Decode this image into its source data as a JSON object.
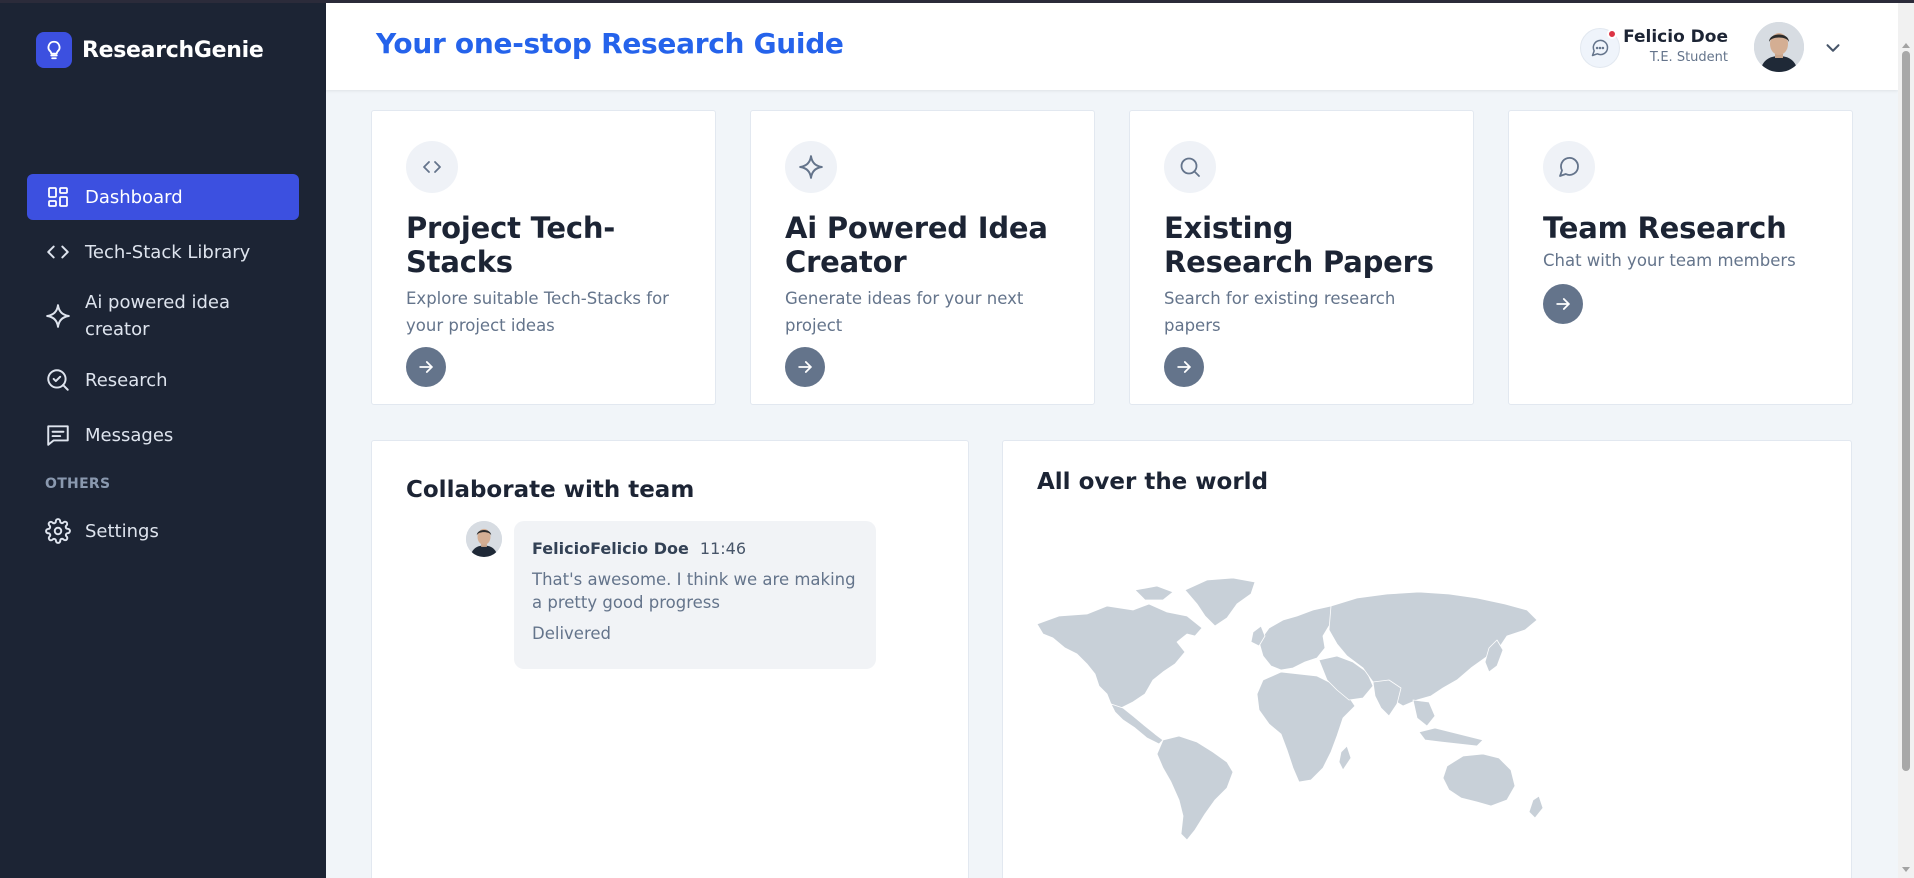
{
  "app": {
    "name": "ResearchGenie",
    "accent": "#3c50e0"
  },
  "sidebar": {
    "items": [
      {
        "label": "Dashboard",
        "icon": "dashboard-grid-icon",
        "active": true
      },
      {
        "label": "Tech-Stack Library",
        "icon": "code-icon"
      },
      {
        "label": "Ai powered idea creator",
        "icon": "sparkle-icon"
      },
      {
        "label": "Research",
        "icon": "search-check-icon"
      },
      {
        "label": "Messages",
        "icon": "message-square-icon"
      }
    ],
    "section_label": "OTHERS",
    "others": [
      {
        "label": "Settings",
        "icon": "gear-icon"
      }
    ]
  },
  "header": {
    "title": "Your one-stop Research Guide",
    "user": {
      "name": "Felicio Doe",
      "role": "T.E. Student"
    },
    "icons": {
      "messages": "chat-bubble-icon",
      "menu": "chevron-down-icon"
    }
  },
  "cards": [
    {
      "title": "Project Tech-Stacks",
      "description": "Explore suitable Tech-Stacks for your project ideas",
      "icon": "code-icon"
    },
    {
      "title": "Ai Powered Idea Creator",
      "description": "Generate ideas for your next project",
      "icon": "sparkle-icon"
    },
    {
      "title": "Existing Research Papers",
      "description": "Search for existing research papers",
      "icon": "search-icon"
    },
    {
      "title": "Team Research",
      "description": "Chat with your team members",
      "icon": "chat-bubble-icon"
    }
  ],
  "collaborate": {
    "title": "Collaborate with team",
    "message": {
      "sender": "FelicioFelicio Doe",
      "time": "11:46",
      "text": "That's awesome. I think we are making a pretty good progress",
      "status": "Delivered"
    }
  },
  "world": {
    "title": "All over the world",
    "map_color": "#c8d0d8"
  }
}
